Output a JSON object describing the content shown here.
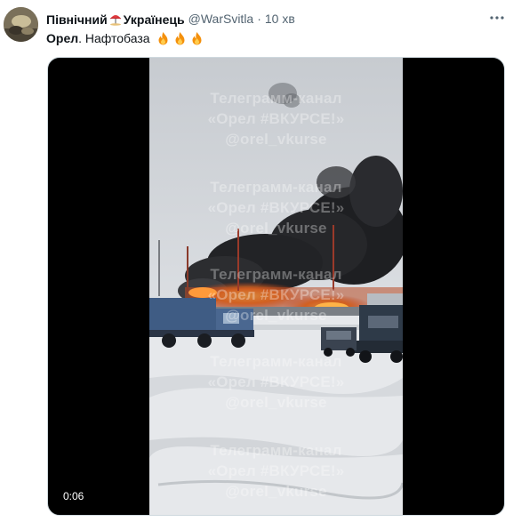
{
  "tweet": {
    "display_name_part1": "Північний",
    "display_name_part2": "Українець",
    "handle": "@WarSvitla",
    "separator": "·",
    "time": "10 хв",
    "text_bold": "Орел",
    "text_rest": ". Нафтобаза",
    "emoji_in_name": "umbrella-on-ground-icon",
    "emoji_after_text": [
      "fire-icon",
      "fire-icon",
      "fire-icon"
    ]
  },
  "video": {
    "elapsed": "0:06",
    "watermark": {
      "line1": "Телеграмм-канал",
      "line2": "«Орел #ВКУРСЕ!»",
      "line3": "@orel_vkurse"
    }
  },
  "colors": {
    "text": "#0f1419",
    "secondary_text": "#536471",
    "media_background": "#000000"
  }
}
